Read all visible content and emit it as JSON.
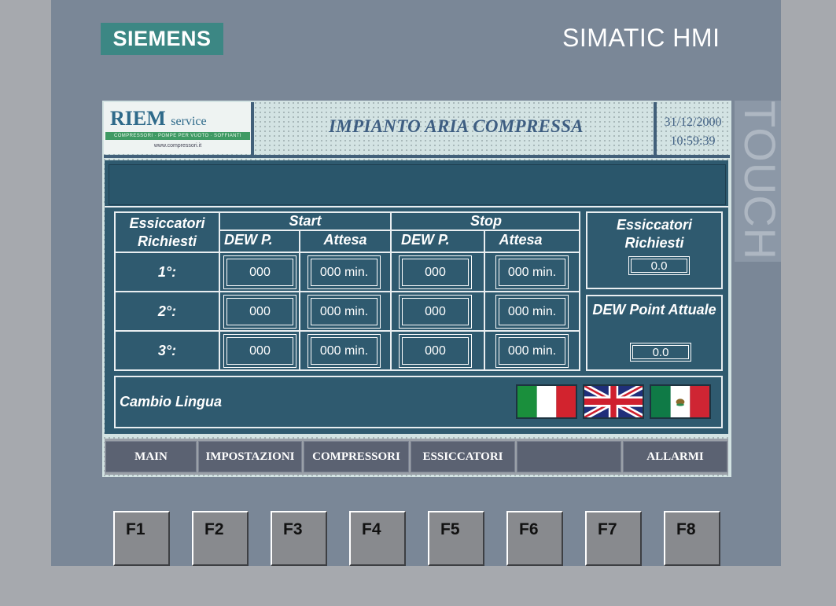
{
  "device": {
    "brand": "SIEMENS",
    "model": "SIMATIC HMI",
    "touch_label": "TOUCH"
  },
  "header": {
    "company_name": "RIEM",
    "company_suffix": "service",
    "company_tagline": "COMPRESSORI · POMPE PER VUOTO · SOFFIANTI",
    "company_web": "www.compressori.it",
    "title": "IMPIANTO ARIA COMPRESSA",
    "date": "31/12/2000",
    "time": "10:59:39"
  },
  "table": {
    "row_header": "Essiccatori Richiesti",
    "start_label": "Start",
    "stop_label": "Stop",
    "dew_label": "DEW P.",
    "wait_label": "Attesa",
    "rows": [
      {
        "label": "1°:",
        "start_dew": "000",
        "start_wait": "000 min.",
        "stop_dew": "000",
        "stop_wait": "000 min."
      },
      {
        "label": "2°:",
        "start_dew": "000",
        "start_wait": "000 min.",
        "stop_dew": "000",
        "stop_wait": "000 min."
      },
      {
        "label": "3°:",
        "start_dew": "000",
        "start_wait": "000 min.",
        "stop_dew": "000",
        "stop_wait": "000 min."
      }
    ]
  },
  "side": {
    "requested_label": "Essiccatori Richiesti",
    "requested_value": "0.0",
    "dew_label": "DEW Point Attuale",
    "dew_value": "0.0"
  },
  "language": {
    "label": "Cambio Lingua",
    "flags": [
      "italy-flag",
      "uk-flag",
      "mexico-flag"
    ]
  },
  "nav": {
    "buttons": [
      "MAIN",
      "IMPOSTAZIONI",
      "COMPRESSORI",
      "ESSICCATORI",
      "",
      "ALLARMI"
    ]
  },
  "fkeys": [
    "F1",
    "F2",
    "F3",
    "F4",
    "F5",
    "F6",
    "F7",
    "F8"
  ],
  "colors": {
    "bezel": "#7a8797",
    "panel": "#2f5a6f",
    "brand_logo": "#3c8784",
    "nav_button": "#5b6272",
    "title_text": "#3e5e82"
  }
}
